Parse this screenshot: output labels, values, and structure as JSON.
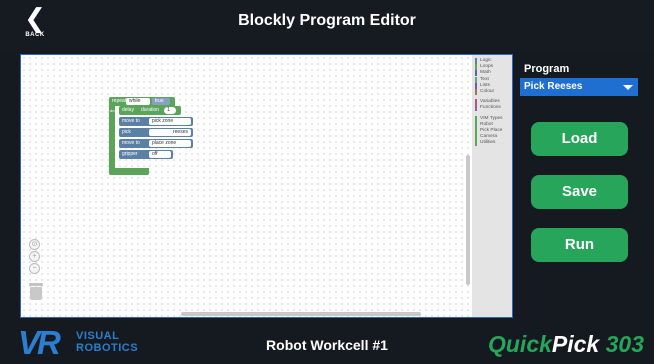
{
  "header": {
    "back_label": "BACK",
    "title": "Blockly Program Editor"
  },
  "toolbox": {
    "groups": [
      [
        {
          "label": "Logic",
          "color": "#5b80a5"
        },
        {
          "label": "Loops",
          "color": "#5ba55b"
        },
        {
          "label": "Math",
          "color": "#5b67a5"
        },
        {
          "label": "Text",
          "color": "#5ba58c"
        },
        {
          "label": "Lists",
          "color": "#745ba5"
        },
        {
          "label": "Colour",
          "color": "#a5745b"
        }
      ],
      [
        {
          "label": "Variables",
          "color": "#a55b80"
        },
        {
          "label": "Functions",
          "color": "#995ba5"
        }
      ],
      [
        {
          "label": "VIM Types",
          "color": "#5ba55b"
        },
        {
          "label": "Robot",
          "color": "#5ba55b"
        },
        {
          "label": "Pick Place",
          "color": "#5ba55b"
        },
        {
          "label": "Camera",
          "color": "#5ba55b"
        },
        {
          "label": "Utilities",
          "color": "#5ba55b"
        }
      ]
    ]
  },
  "blocks": {
    "repeat": {
      "keyword": "repeat",
      "mode": "while",
      "value": "true",
      "do": "do"
    },
    "delay": {
      "label": "delay",
      "unit": "duration",
      "value": "1"
    },
    "move1": {
      "label": "move to",
      "value": "pick zone"
    },
    "pick": {
      "label": "pick",
      "value": "reeses"
    },
    "move2": {
      "label": "move to",
      "value": "place zone"
    },
    "gripper": {
      "label": "gripper",
      "value": "off"
    }
  },
  "program": {
    "label": "Program",
    "selected": "Pick Reeses"
  },
  "buttons": {
    "load": "Load",
    "save": "Save",
    "run": "Run"
  },
  "footer": {
    "logo_mark": "VR",
    "logo_line1": "VISUAL",
    "logo_line2": "ROBOTICS",
    "workcell": "Robot Workcell #1",
    "brand_part1": "Quick",
    "brand_part2": "Pick",
    "brand_number": "303"
  },
  "colors": {
    "accent_green": "#27a55a",
    "accent_blue": "#1f6fd1",
    "loop_green": "#5ba55b"
  }
}
